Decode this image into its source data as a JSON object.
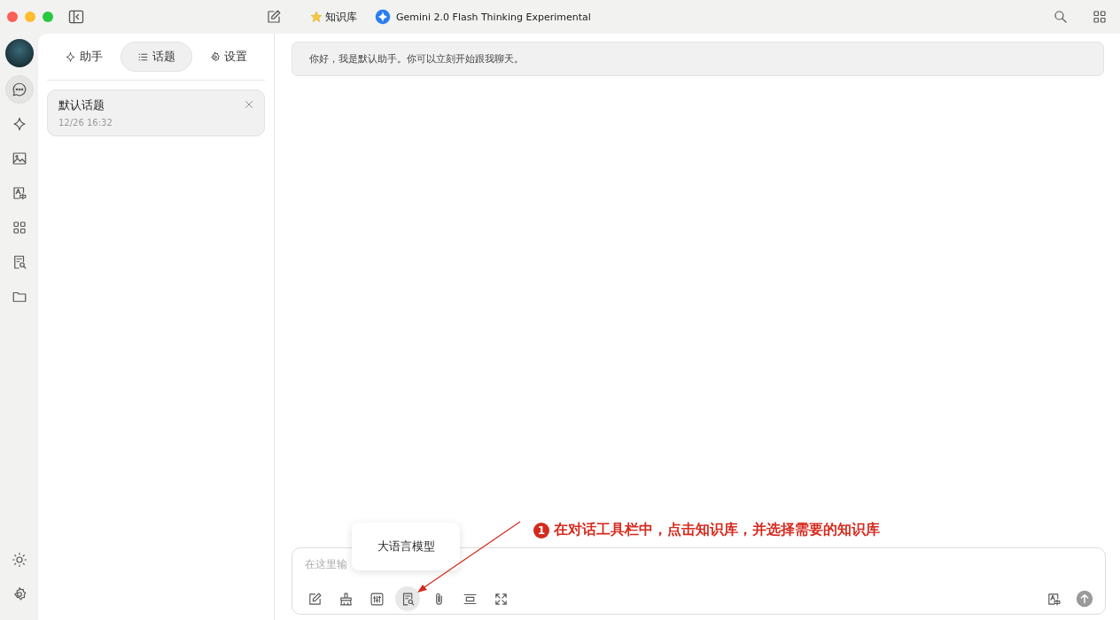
{
  "title_bar": {
    "knowledge_label": "知识库",
    "model_name": "Gemini 2.0 Flash Thinking Experimental"
  },
  "rail": {
    "items": [
      {
        "kind": "chat",
        "selected": true
      },
      {
        "kind": "sparkle",
        "selected": false
      },
      {
        "kind": "image",
        "selected": false
      },
      {
        "kind": "translate",
        "selected": false
      },
      {
        "kind": "apps",
        "selected": false
      },
      {
        "kind": "doc-search",
        "selected": false
      },
      {
        "kind": "folder",
        "selected": false
      }
    ],
    "bottom_items": [
      {
        "kind": "sun"
      },
      {
        "kind": "gear"
      }
    ]
  },
  "tabs": [
    {
      "label": "助手",
      "kind": "sparkle",
      "selected": false
    },
    {
      "label": "话题",
      "kind": "list",
      "selected": true
    },
    {
      "label": "设置",
      "kind": "gear",
      "selected": false
    }
  ],
  "topics": [
    {
      "title": "默认话题",
      "time": "12/26 16:32",
      "selected": true
    }
  ],
  "messages": [
    {
      "text": "你好，我是默认助手。你可以立刻开始跟我聊天。"
    }
  ],
  "input": {
    "placeholder": "在这里输",
    "toolbar": [
      {
        "kind": "edit",
        "selected": false
      },
      {
        "kind": "broom",
        "selected": false
      },
      {
        "kind": "sliders",
        "selected": false
      },
      {
        "kind": "doc-search",
        "selected": true
      },
      {
        "kind": "paperclip",
        "selected": false
      },
      {
        "kind": "expand-lines",
        "selected": false
      },
      {
        "kind": "fullscreen",
        "selected": false
      }
    ],
    "right_tools": [
      {
        "kind": "translate"
      },
      {
        "kind": "send"
      }
    ]
  },
  "tooltip": {
    "text": "大语言模型"
  },
  "annotation": {
    "number": "1",
    "text": "在对话工具栏中，点击知识库，并选择需要的知识库"
  }
}
